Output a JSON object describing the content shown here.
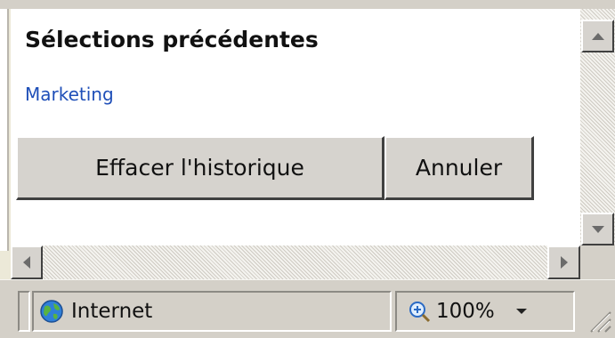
{
  "dialog": {
    "heading": "Sélections précédentes",
    "history_items": [
      "Marketing"
    ],
    "clear_button": "Effacer l'historique",
    "cancel_button": "Annuler"
  },
  "status_bar": {
    "zone": "Internet",
    "zoom": "100%",
    "zone_icon": "globe-icon",
    "zoom_icon": "magnifier-icon"
  },
  "colors": {
    "link": "#1f4fb8",
    "button_face": "#d6d3ce",
    "chrome": "#d4d0c8"
  }
}
